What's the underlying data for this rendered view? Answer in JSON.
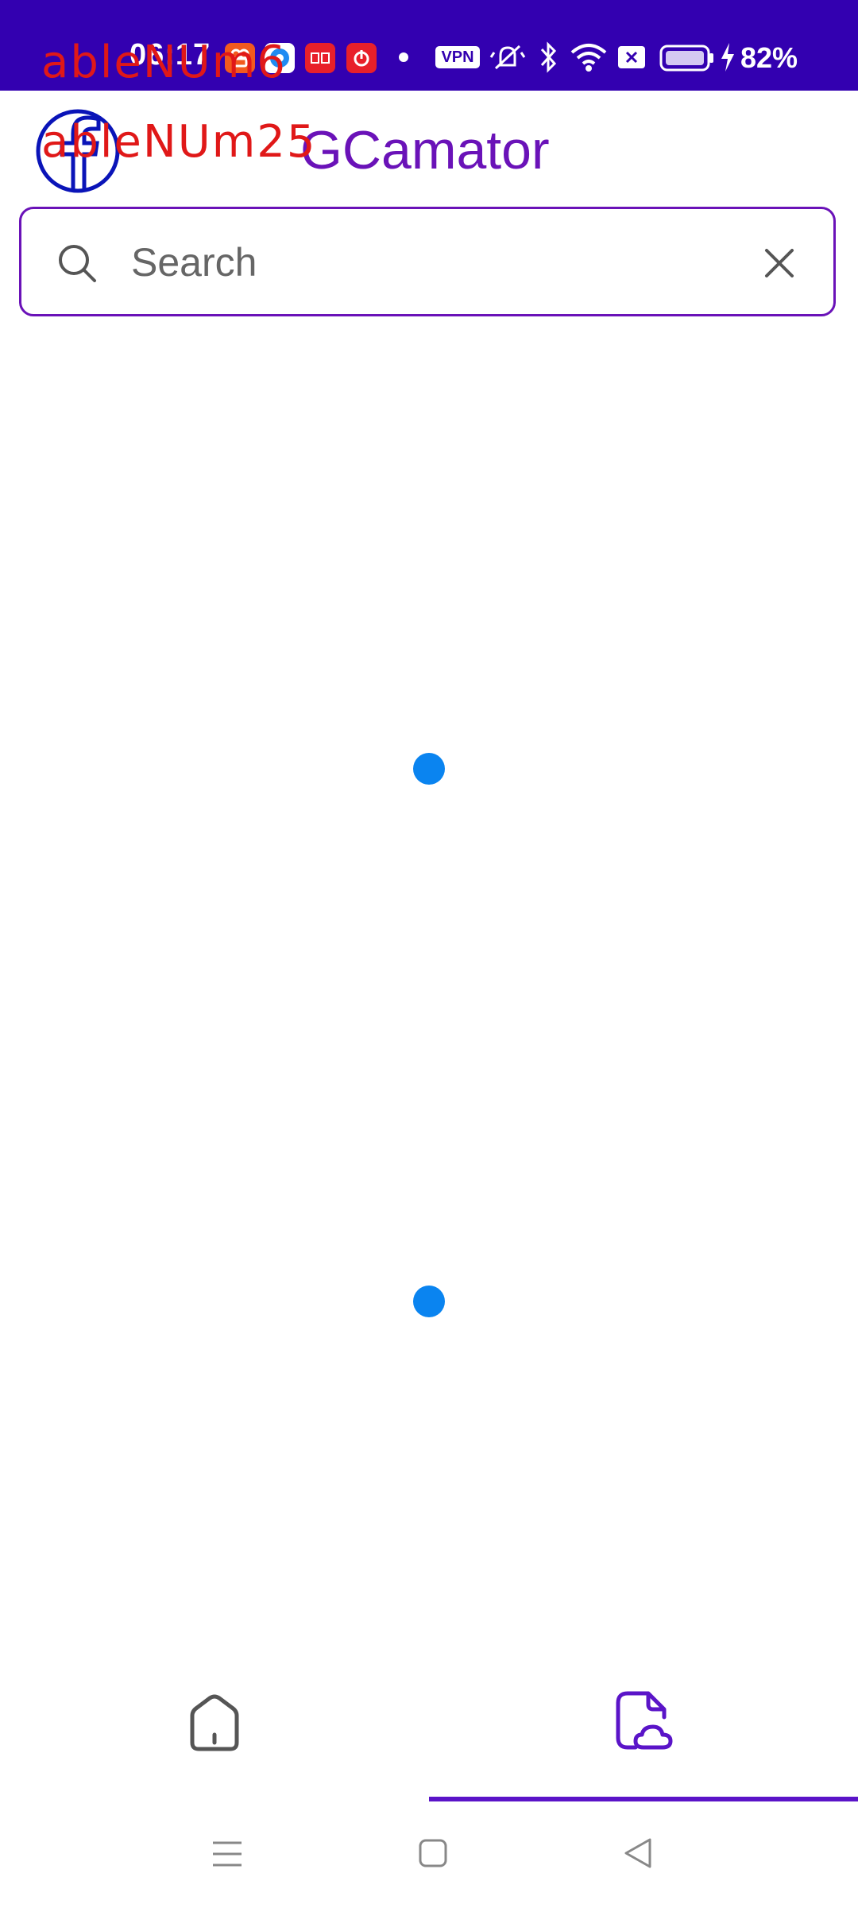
{
  "status_bar": {
    "time": "06:17",
    "vpn_label": "VPN",
    "battery_percent": "82%",
    "background_color": "#3300b0",
    "notification_icons": [
      "kuaishou-icon",
      "browser-icon",
      "qidian-icon",
      "netease-music-icon"
    ],
    "system_icons": [
      "vpn-icon",
      "silent-icon",
      "bluetooth-icon",
      "wifi-icon",
      "sim-icon",
      "battery-icon",
      "charging-icon"
    ]
  },
  "overlay": {
    "label_1": "ableNUm6",
    "label_2": "ableNUm25"
  },
  "header": {
    "logo_icon": "facebook-logo-icon",
    "title": "GCamator",
    "title_color": "#6a12b8"
  },
  "search": {
    "placeholder": "Search",
    "value": "",
    "border_color": "#6a12b8"
  },
  "content": {
    "loading_dot_color": "#0a84f0"
  },
  "bottom_nav": {
    "items": [
      {
        "name": "home",
        "icon": "home-icon",
        "selected": false
      },
      {
        "name": "files",
        "icon": "cloud-file-icon",
        "selected": true
      }
    ],
    "accent_color": "#5a14c8"
  },
  "system_nav": {
    "items": [
      "menu-icon",
      "home-square-icon",
      "back-icon"
    ]
  }
}
